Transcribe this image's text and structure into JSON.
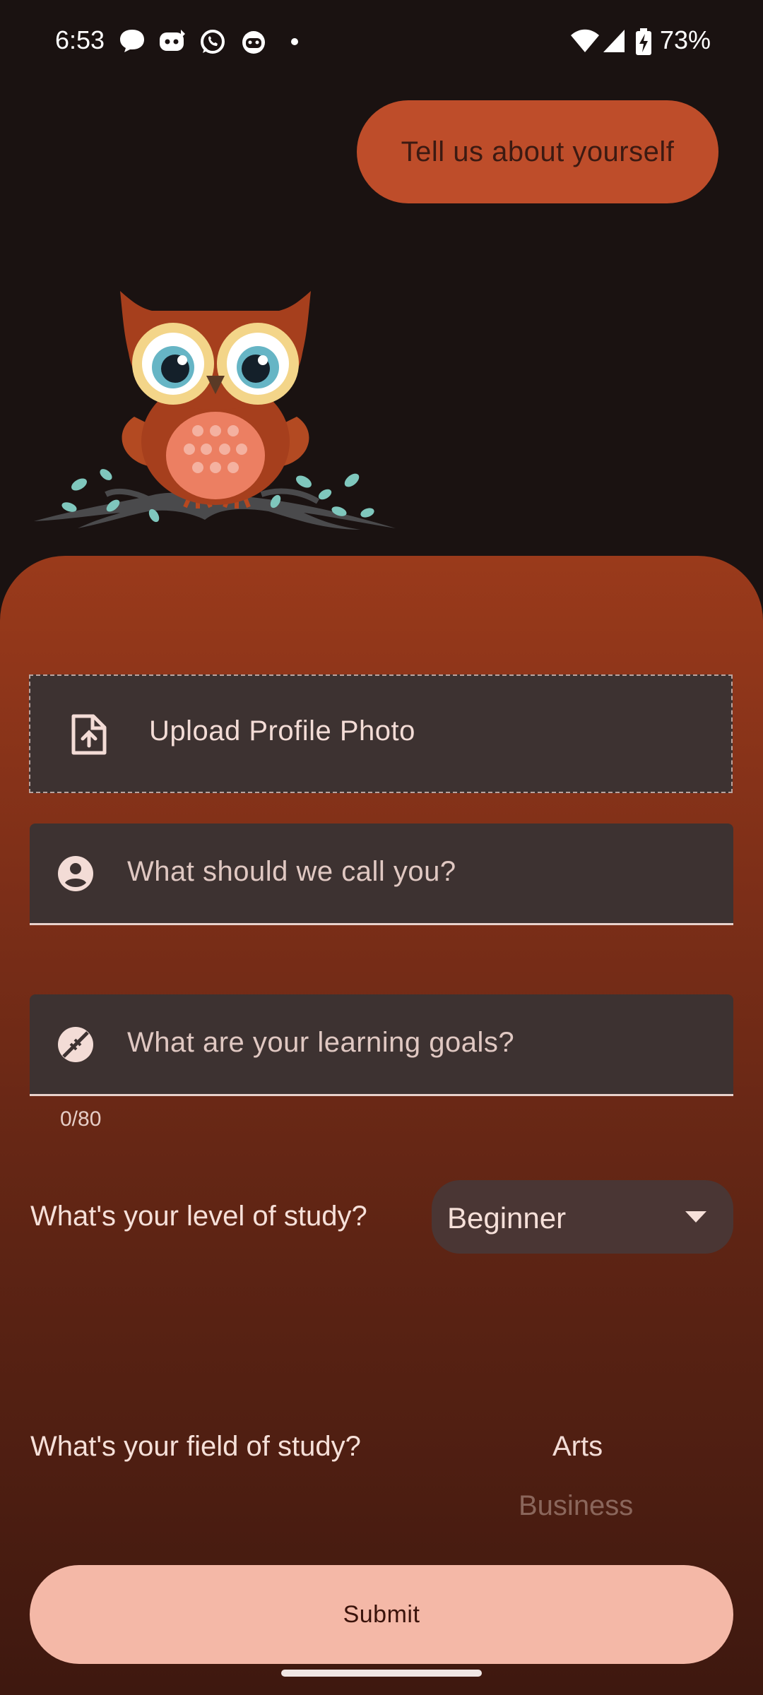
{
  "status_bar": {
    "time": "6:53",
    "battery": "73%",
    "icons": [
      "chat-bubble-icon",
      "discord-icon",
      "whatsapp-icon",
      "cat-icon",
      "dot-icon",
      "wifi-icon",
      "signal-icon",
      "battery-charging-icon"
    ]
  },
  "bubble": {
    "text": "Tell us about yourself"
  },
  "upload": {
    "label": "Upload Profile Photo",
    "icon": "upload-file-icon"
  },
  "name_field": {
    "placeholder": "What should we call you?",
    "icon": "account-circle-icon"
  },
  "goals_field": {
    "placeholder": "What are your learning goals?",
    "icon": "football-icon",
    "counter": "0/80"
  },
  "level": {
    "label": "What's your level of study?",
    "selected": "Beginner"
  },
  "field_of_study": {
    "label": "What's your field of study?",
    "options": [
      "Arts",
      "Business"
    ]
  },
  "submit": {
    "label": "Submit"
  },
  "colors": {
    "background": "#1a1211",
    "accent": "#be4d2a",
    "submit_bg": "#f4b8a7",
    "field_bg": "#3d3231"
  }
}
